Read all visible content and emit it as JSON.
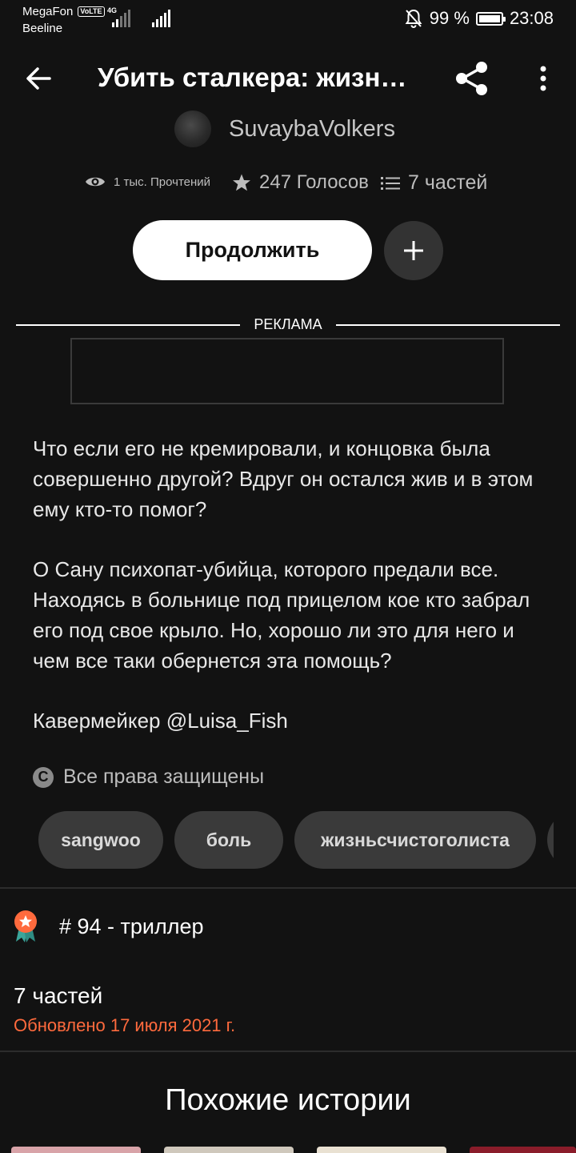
{
  "status_bar": {
    "carrier_1": "MegaFon",
    "volte_badge": "VoLTE",
    "carrier_2": "Beeline",
    "network": "4G",
    "battery_text": "99 %",
    "battery_level": 0.99,
    "time": "23:08",
    "icons": [
      "mute-bell-icon",
      "battery-icon",
      "signal-icon"
    ]
  },
  "header": {
    "title": "Убить сталкера: жизнь…",
    "icons": [
      "back-arrow-icon",
      "share-icon",
      "more-vert-icon"
    ]
  },
  "author": {
    "name": "SuvaybaVolkers"
  },
  "stats": {
    "reads": "1 тыс. Прочтений",
    "votes": "247 Голосов",
    "parts": "7 частей"
  },
  "actions": {
    "continue_label": "Продолжить"
  },
  "ad": {
    "label": "РЕКЛАМА"
  },
  "description": {
    "paragraphs": [
      "Что если его не кремировали, и концовка была совершенно другой? Вдруг он остался жив и в этом ему кто-то помог?",
      "О Сану психопат-убийца, которого предали все. Находясь в больнице под прицелом кое кто забрал его под свое крыло. Но, хорошо ли это для него и чем все таки обернется эта помощь?",
      "Кавермейкер @Luisa_Fish"
    ]
  },
  "copyright": {
    "icon": "copyright-icon",
    "text": "Все права защищены"
  },
  "tags": [
    "sangwoo",
    "боль",
    "жизньсчистоголиста"
  ],
  "ranking": {
    "icon": "award-badge-icon",
    "text": "# 94 - триллер"
  },
  "parts_info": {
    "count": "7 частей",
    "updated": "Обновлено 17 июля 2021 г."
  },
  "similar": {
    "title": "Похожие истории"
  },
  "colors": {
    "background": "#121212",
    "accent_orange": "#ff6a3d",
    "button_white": "#ffffff",
    "chip_gray": "#3a3a3a"
  }
}
